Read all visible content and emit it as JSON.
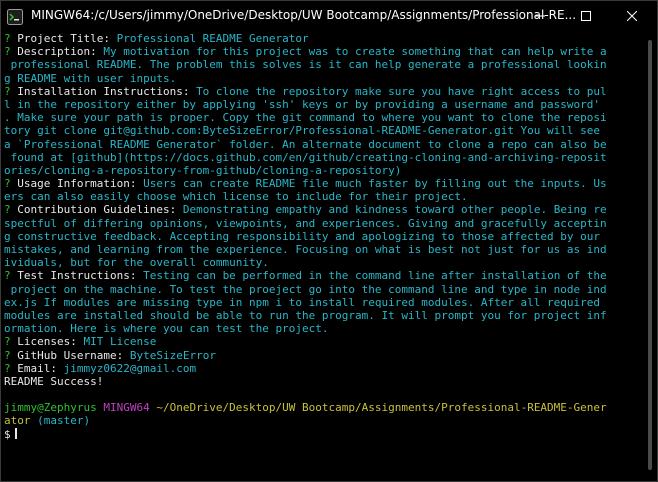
{
  "window": {
    "title": "MINGW64:/c/Users/jimmy/OneDrive/Desktop/UW Bootcamp/Assignments/Professional-RE...",
    "icon": "mingw-terminal-icon",
    "controls": {
      "minimize": "minimize-icon",
      "maximize": "maximize-icon",
      "close": "close-icon"
    }
  },
  "colors": {
    "background": "#000000",
    "prompt_marker": "#30c030",
    "answer": "#29b6c8",
    "user_host": "#30c030",
    "shell": "#c040c0",
    "path": "#c8c03a",
    "branch": "#29b6c8"
  },
  "terminal": {
    "prompts": [
      {
        "marker": "?",
        "label": "Project Title:",
        "lines": [
          "Professional README Generator"
        ]
      },
      {
        "marker": "?",
        "label": "Description:",
        "lines": [
          "My motivation for this project was to create something that can help write a",
          " professional README. The problem this solves is it can help generate a professional lookin",
          "g README with user inputs."
        ]
      },
      {
        "marker": "?",
        "label": "Installation Instructions:",
        "lines": [
          "To clone the repository make sure you have right access to pul",
          "l in the repository either by applying 'ssh' keys or by providing a username and password'",
          ". Make sure your path is proper. Copy the git command to where you want to clone the reposi",
          "tory git clone git@github.com:ByteSizeError/Professional-README-Generator.git You will see",
          "a `Professional README Generator` folder. An alternate document to clone a repo can also be",
          " found at [github](https://docs.github.com/en/github/creating-cloning-and-archiving-reposit",
          "ories/cloning-a-repository-from-github/cloning-a-repository)"
        ]
      },
      {
        "marker": "?",
        "label": "Usage Information:",
        "lines": [
          "Users can create README file much faster by filling out the inputs. Us",
          "ers can also easily choose which license to include for their project."
        ]
      },
      {
        "marker": "?",
        "label": "Contribution Guidelines:",
        "lines": [
          "Demonstrating empathy and kindness toward other people. Being re",
          "spectful of differing opinions, viewpoints, and experiences. Giving and gracefully acceptin",
          "g constructive feedback. Accepting responsibility and apologizing to those affected by our",
          "mistakes, and learning from the experience. Focusing on what is best not just for us as ind",
          "ividuals, but for the overall community."
        ]
      },
      {
        "marker": "?",
        "label": "Test Instructions:",
        "lines": [
          "Testing can be performed in the command line after installation of the",
          " project on the machine. To test the proeject go into the command line and type in node ind",
          "ex.js If modules are missing type in npm i to install required modules. After all required",
          "modules are installed should be able to run the program. It will prompt you for project inf",
          "ormation. Here is where you can test the project."
        ]
      },
      {
        "marker": "?",
        "label": "Licenses:",
        "lines": [
          "MIT License"
        ]
      },
      {
        "marker": "?",
        "label": "GitHub Username:",
        "lines": [
          "ByteSizeError"
        ]
      },
      {
        "marker": "?",
        "label": "Email:",
        "lines": [
          "jimmyz0622@gmail.com"
        ]
      }
    ],
    "result": "README Success!",
    "shell_prompt": {
      "user_host": "jimmy@Zephyrus",
      "shell": "MINGW64",
      "path_line1": "~/OneDrive/Desktop/UW Bootcamp/Assignments/Professional-README-Gener",
      "path_line2": "ator",
      "branch": "(master)",
      "symbol": "$"
    }
  }
}
